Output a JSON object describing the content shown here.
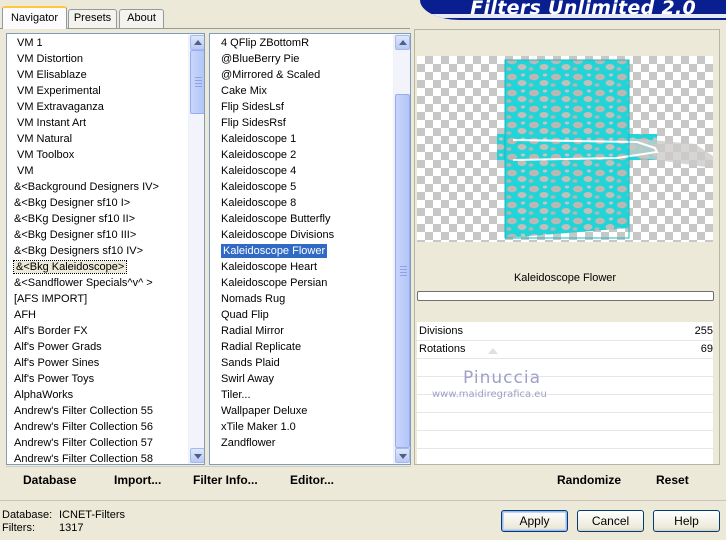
{
  "tabs": [
    {
      "label": "Navigator",
      "active": true
    },
    {
      "label": "Presets",
      "active": false
    },
    {
      "label": "About",
      "active": false
    }
  ],
  "banner_title": "Filters Unlimited 2.0",
  "categories": [
    "VM 1",
    "VM Distortion",
    "VM Elisablaze",
    "VM Experimental",
    "VM Extravaganza",
    "VM Instant Art",
    "VM Natural",
    "VM Toolbox",
    "VM",
    "&<Background Designers IV>",
    "&<Bkg Designer sf10 I>",
    "&<BKg Designer sf10 II>",
    "&<Bkg Designer sf10 III>",
    "&<Bkg Designers sf10 IV>",
    "&<Bkg Kaleidoscope>",
    "&<Sandflower Specials^v^ >",
    "[AFS IMPORT]",
    "AFH",
    "Alf's Border FX",
    "Alf's Power Grads",
    "Alf's Power Sines",
    "Alf's Power Toys",
    "AlphaWorks",
    "Andrew's Filter Collection 55",
    "Andrew's Filter Collection 56",
    "Andrew's Filter Collection 57",
    "Andrew's Filter Collection 58"
  ],
  "selected_category": "&<Bkg Kaleidoscope>",
  "filters": [
    "4 QFlip ZBottomR",
    "@BlueBerry Pie",
    "@Mirrored & Scaled",
    "Cake Mix",
    "Flip SidesLsf",
    "Flip SidesRsf",
    "Kaleidoscope 1",
    "Kaleidoscope 2",
    "Kaleidoscope 4",
    "Kaleidoscope 5",
    "Kaleidoscope 8",
    "Kaleidoscope Butterfly",
    "Kaleidoscope Divisions",
    "Kaleidoscope Flower",
    "Kaleidoscope Heart",
    "Kaleidoscope Persian",
    "Nomads Rug",
    "Quad Flip",
    "Radial Mirror",
    "Radial Replicate",
    "Sands Plaid",
    "Swirl Away",
    "Tiler...",
    "Wallpaper Deluxe",
    "xTile Maker 1.0",
    "Zandflower"
  ],
  "selected_filter": "Kaleidoscope Flower",
  "preview": {
    "filter_name": "Kaleidoscope Flower",
    "accent_color": "#1ed6d6"
  },
  "params": [
    {
      "label": "Divisions",
      "value": "255"
    },
    {
      "label": "Rotations",
      "value": "69"
    }
  ],
  "watermark": {
    "title": "Pinuccia",
    "url": "www.maidiregrafica.eu"
  },
  "left_buttons": {
    "database": "Database",
    "import": "Import...",
    "filter_info": "Filter Info...",
    "editor": "Editor..."
  },
  "right_buttons": {
    "randomize": "Randomize",
    "reset": "Reset"
  },
  "status": {
    "database_label": "Database:",
    "database_value": "ICNET-Filters",
    "filters_label": "Filters:",
    "filters_value": "1317"
  },
  "dialog_buttons": {
    "apply": "Apply",
    "cancel": "Cancel",
    "help": "Help"
  }
}
